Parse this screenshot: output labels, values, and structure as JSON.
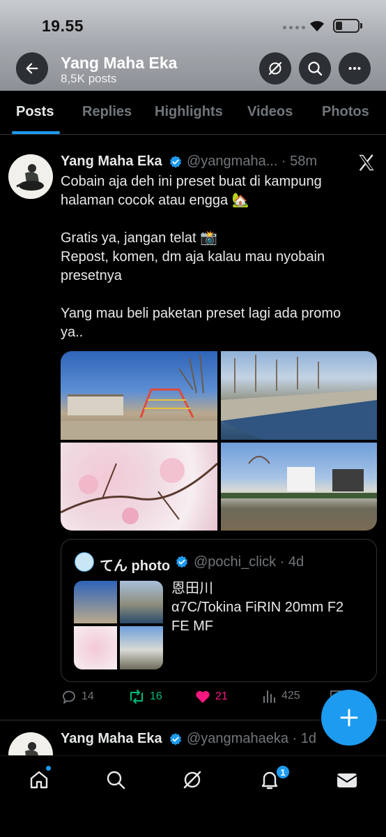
{
  "status_bar": {
    "time": "19.55"
  },
  "header": {
    "title": "Yang Maha Eka",
    "subtitle": "8,5K posts"
  },
  "tabs": [
    {
      "label": "Posts",
      "active": true
    },
    {
      "label": "Replies",
      "active": false
    },
    {
      "label": "Highlights",
      "active": false
    },
    {
      "label": "Videos",
      "active": false
    },
    {
      "label": "Photos",
      "active": false
    }
  ],
  "tweet": {
    "name": "Yang Maha Eka",
    "handle_time": "@yangmaha... · 58m",
    "lines": [
      "Cobain aja deh ini preset buat di kampung",
      "halaman cocok atau engga 🏡",
      "",
      "Gratis ya, jangan telat 📸",
      "Repost, komen, dm aja kalau mau nyobain",
      "presetnya",
      "",
      "Yang mau beli paketan preset lagi ada promo",
      "ya.."
    ],
    "quote": {
      "name": "てん photo",
      "handle_time": "@pochi_click · 4d",
      "lines": [
        "恩田川",
        "α7C/Tokina FiRIN 20mm F2",
        "FE MF"
      ]
    },
    "stats": {
      "replies": "14",
      "reposts": "16",
      "likes": "21",
      "views": "425"
    }
  },
  "next_tweet": {
    "name": "Yang Maha Eka",
    "handle_time": "@yangmahaeka · 1d"
  },
  "bottom_nav": {
    "notification_count": "1"
  },
  "colors": {
    "accent": "#1d9bf0",
    "retweet": "#00ba7c",
    "like": "#f91880",
    "muted": "#71767b",
    "verified": "#1d9bf0"
  },
  "icons": [
    "back-arrow-icon",
    "grok-icon",
    "search-icon",
    "more-icon",
    "verified-icon",
    "x-logo-icon",
    "reply-icon",
    "repost-icon",
    "like-icon",
    "views-icon",
    "compose-plus-icon",
    "home-icon",
    "explore-icon",
    "notifications-icon",
    "messages-icon"
  ]
}
